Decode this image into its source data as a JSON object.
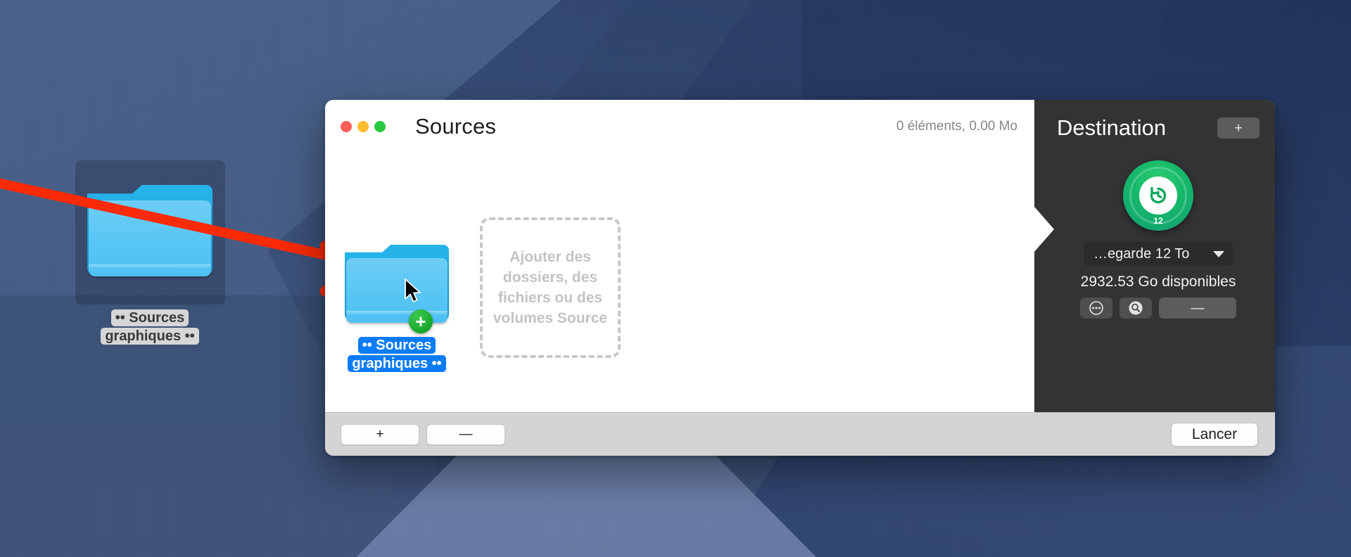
{
  "desktop": {
    "icon": {
      "name": "•• Sources graphiques ••",
      "icon_glyph": "folder-icon"
    }
  },
  "annotation": {
    "arrow_color": "#f92a06",
    "arrow_icon": "red-arrow-icon"
  },
  "window": {
    "traffic_lights": {
      "close": "close-window-button",
      "minimize": "minimize-window-button",
      "zoom": "zoom-window-button",
      "close_color": "#ff5f57",
      "minimize_color": "#febc2e",
      "zoom_color": "#28c840"
    },
    "sources": {
      "title": "Sources",
      "count_label": "0 éléments, 0.00 Mo",
      "dropzone_text": "Ajouter des dossiers, des fichiers ou des volumes Source",
      "dragged_item": {
        "label": "•• Sources graphiques ••",
        "badge": "+",
        "badge_color": "#16a82c",
        "selection_color": "#0a7cf6"
      }
    },
    "destination": {
      "title": "Destination",
      "add_button": "+",
      "disk": {
        "icon": "time-machine-disk-icon",
        "badge": "12",
        "accent_color": "#17b96a"
      },
      "select_value": "…egarde 12 To",
      "free_space": "2932.53 Go disponibles",
      "options_button_icon": "ellipsis-circle-icon",
      "reveal_button_icon": "search-icon",
      "remove_button": "—"
    },
    "footer": {
      "add_label": "+",
      "remove_label": "—",
      "launch_label": "Lancer"
    }
  }
}
